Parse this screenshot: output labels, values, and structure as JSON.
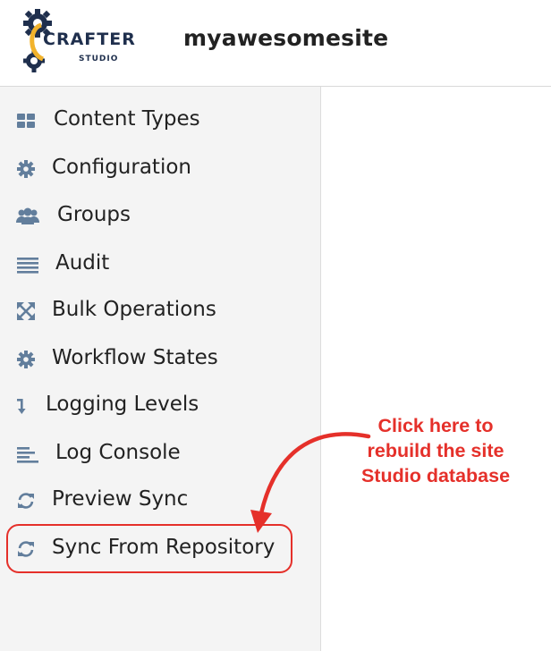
{
  "header": {
    "site_name": "myawesomesite",
    "logo": {
      "brand": "CRAFTER",
      "product": "STUDIO",
      "icon": "gear-icon"
    }
  },
  "sidebar": {
    "items": [
      {
        "label": "Content Types",
        "icon": "grid-icon"
      },
      {
        "label": "Configuration",
        "icon": "gear-icon"
      },
      {
        "label": "Groups",
        "icon": "users-icon"
      },
      {
        "label": "Audit",
        "icon": "list-icon"
      },
      {
        "label": "Bulk Operations",
        "icon": "expand-arrows-icon"
      },
      {
        "label": "Workflow States",
        "icon": "gear-icon"
      },
      {
        "label": "Logging Levels",
        "icon": "level-down-icon"
      },
      {
        "label": "Log Console",
        "icon": "align-left-icon"
      },
      {
        "label": "Preview Sync",
        "icon": "refresh-icon"
      },
      {
        "label": "Sync From Repository",
        "icon": "refresh-icon"
      }
    ]
  },
  "annotation": {
    "lines": [
      "Click here to",
      "rebuild the site",
      "Studio database"
    ],
    "color": "#e5302a"
  },
  "colors": {
    "icon": "#627e9c",
    "text": "#222222",
    "sidebar_bg": "#f4f4f4",
    "logo_navy": "#1f2f4d",
    "logo_gold": "#f2b32c"
  }
}
